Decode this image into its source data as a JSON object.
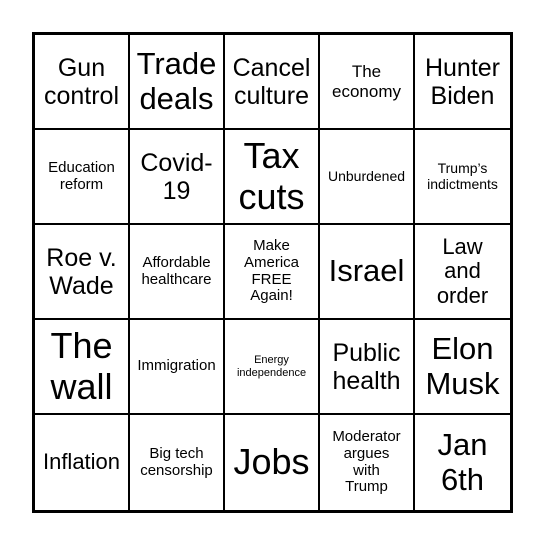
{
  "card": {
    "cells": [
      {
        "text": "Gun\ncontrol",
        "size": "s-ml"
      },
      {
        "text": "Trade\ndeals",
        "size": "s-l"
      },
      {
        "text": "Cancel\nculture",
        "size": "s-ml"
      },
      {
        "text": "The\neconomy",
        "size": "s-sm"
      },
      {
        "text": "Hunter\nBiden",
        "size": "s-ml"
      },
      {
        "text": "Education\nreform",
        "size": "s-s"
      },
      {
        "text": "Covid-\n19",
        "size": "s-ml"
      },
      {
        "text": "Tax\ncuts",
        "size": "s-xl"
      },
      {
        "text": "Unburdened",
        "size": "s-xs"
      },
      {
        "text": "Trump’s\nindictments",
        "size": "s-xs"
      },
      {
        "text": "Roe v.\nWade",
        "size": "s-ml"
      },
      {
        "text": "Affordable\nhealthcare",
        "size": "s-s"
      },
      {
        "text": "Make\nAmerica\nFREE\nAgain!",
        "size": "s-s"
      },
      {
        "text": "Israel",
        "size": "s-l"
      },
      {
        "text": "Law\nand\norder",
        "size": "s-m"
      },
      {
        "text": "The\nwall",
        "size": "s-xl"
      },
      {
        "text": "Immigration",
        "size": "s-s"
      },
      {
        "text": "Energy\nindependence",
        "size": "s-xxs"
      },
      {
        "text": "Public\nhealth",
        "size": "s-ml"
      },
      {
        "text": "Elon\nMusk",
        "size": "s-l"
      },
      {
        "text": "Inflation",
        "size": "s-m"
      },
      {
        "text": "Big tech\ncensorship",
        "size": "s-s"
      },
      {
        "text": "Jobs",
        "size": "s-xl"
      },
      {
        "text": "Moderator\nargues\nwith\nTrump",
        "size": "s-s"
      },
      {
        "text": "Jan\n6th",
        "size": "s-l"
      }
    ]
  }
}
